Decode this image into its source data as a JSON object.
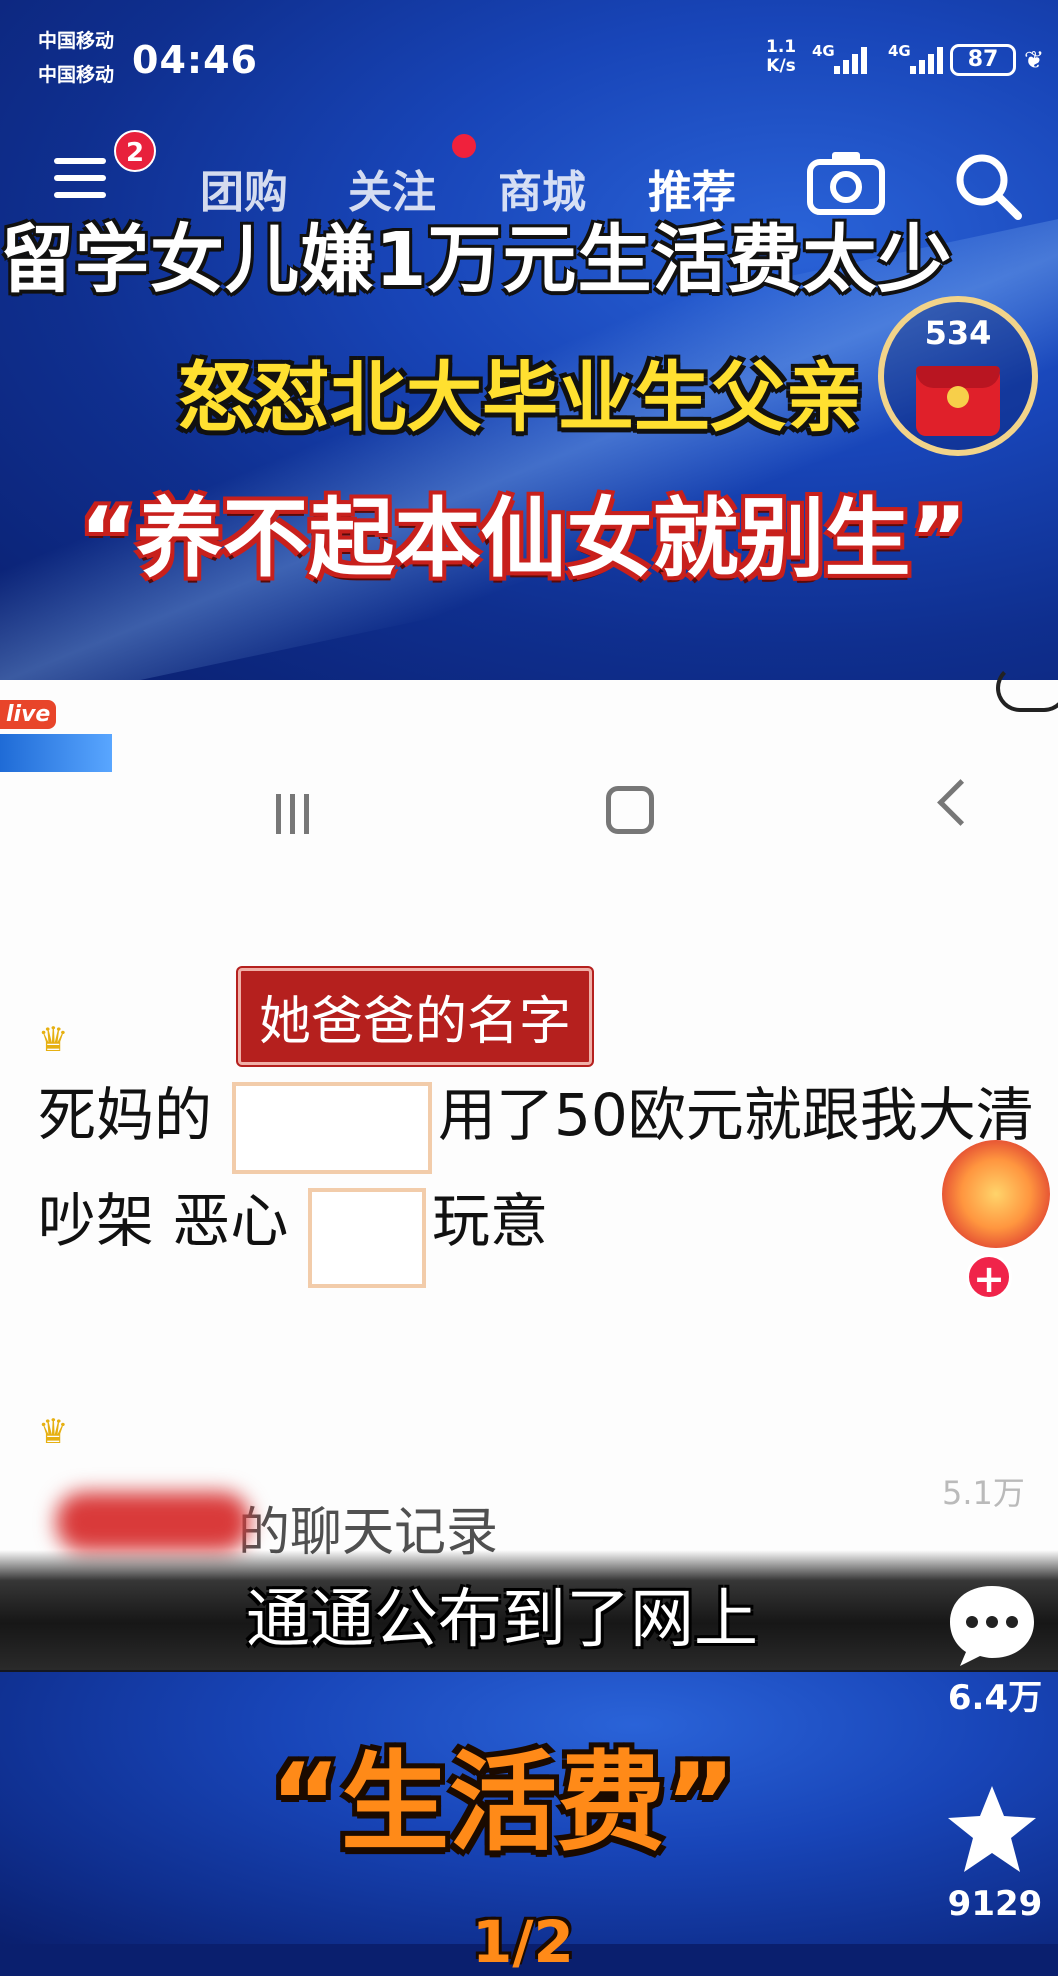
{
  "status_bar": {
    "carrier1": "中国移动",
    "carrier2": "中国移动",
    "time": "04:46",
    "net_speed_value": "1.1",
    "net_speed_unit": "K/s",
    "net_type1": "4G",
    "net_type2": "4G",
    "battery": "87"
  },
  "top_nav": {
    "menu_badge": "2",
    "tabs": [
      {
        "label": "团购"
      },
      {
        "label": "关注"
      },
      {
        "label": "商城"
      },
      {
        "label": "推荐"
      }
    ]
  },
  "video_top": {
    "headline1": "留学女儿嫌1万元生活费太少",
    "headline2": "怒怼北大毕业生父亲",
    "headline3": "“养不起本仙女就别生”"
  },
  "red_packet": {
    "count": "534"
  },
  "embedded_screenshot": {
    "live_tag": "live",
    "name_tag": "她爸爸的名字",
    "line1_a": "死妈的",
    "line1_b": "用了50欧元就跟我大清",
    "line2_a": "吵架 恶心",
    "line2_b": "玩意",
    "line3": "的聊天记录"
  },
  "side_actions": {
    "likes": "5.1万",
    "comments": "6.4万",
    "favorites": "9129"
  },
  "subtitle": "通通公布到了网上",
  "video_bottom": {
    "headline": "“生活费”",
    "page_indicator": "1/2"
  },
  "colors": {
    "accent_red": "#e8213c",
    "headline_yellow": "#ffe030",
    "bottom_orange": "#ff8a18",
    "bg_blue": "#1845b8"
  }
}
